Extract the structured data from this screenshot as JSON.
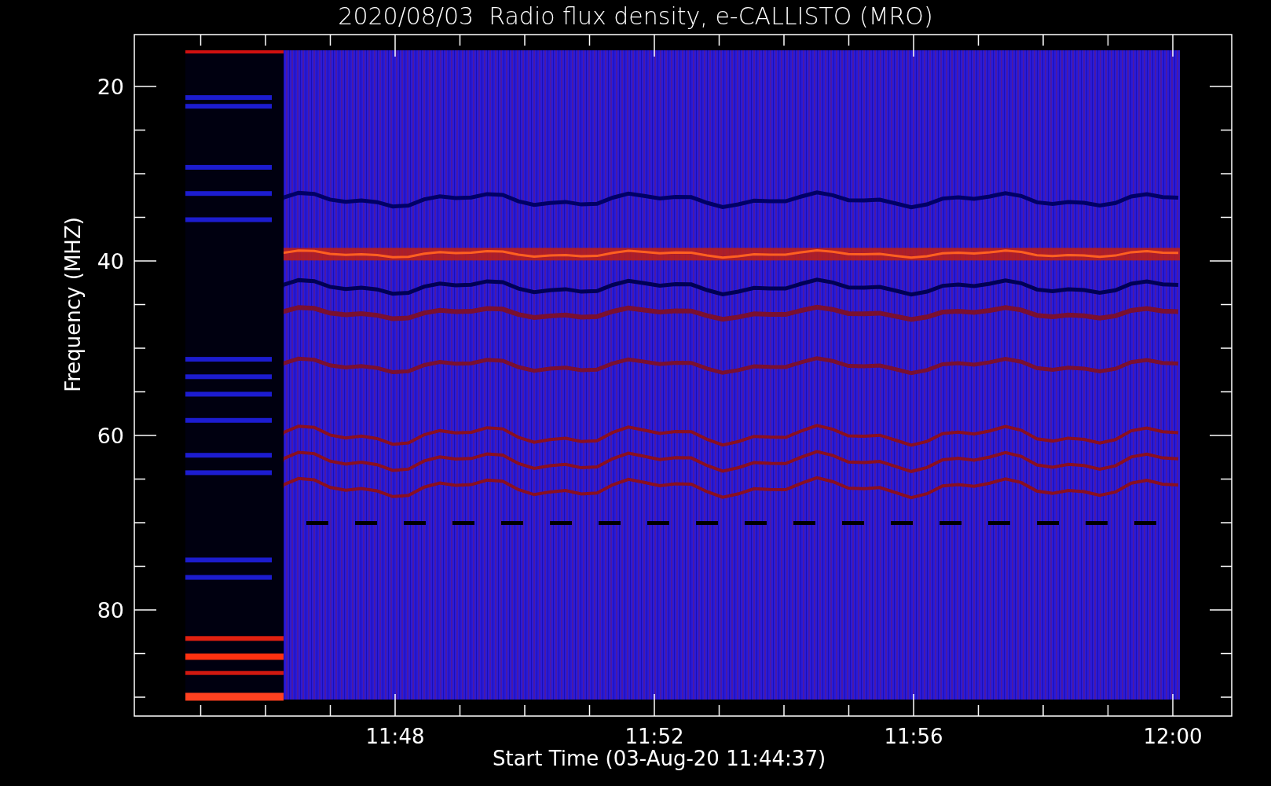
{
  "title": "2020/08/03  Radio flux density, e-CALLISTO (MRO)",
  "y_axis": {
    "label": "Frequency (MHZ)",
    "ticks": [
      "20",
      "40",
      "60",
      "80"
    ]
  },
  "x_axis": {
    "label": "Start Time (03-Aug-20 11:44:37)",
    "ticks": [
      "11:48",
      "11:52",
      "11:56",
      "12:00"
    ]
  }
}
